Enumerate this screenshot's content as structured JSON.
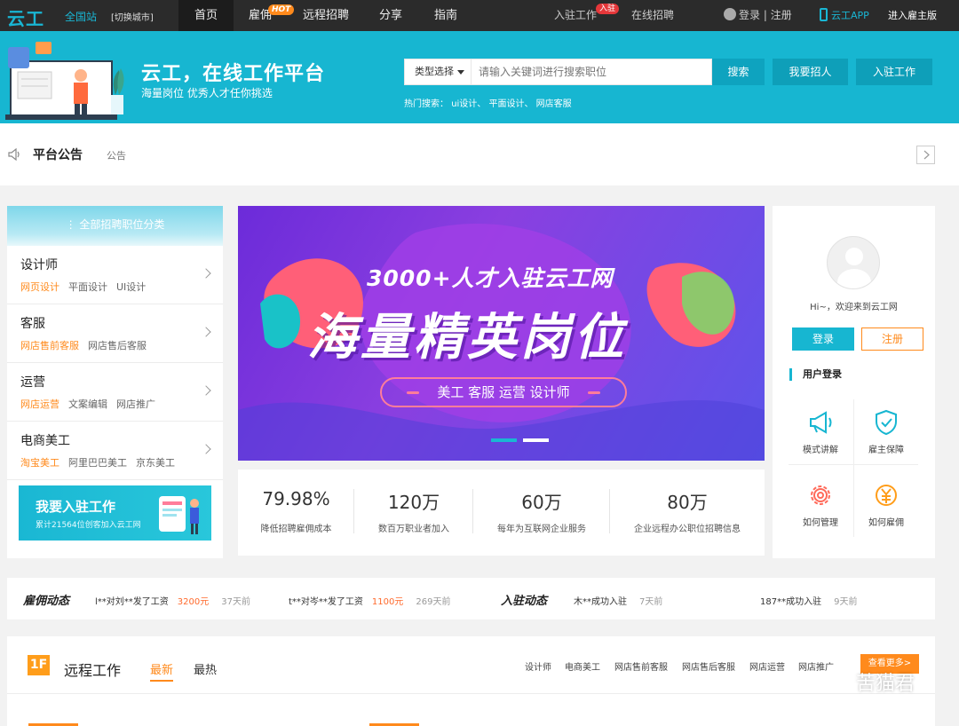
{
  "topbar": {
    "logo": "云工",
    "city": "全国站",
    "switch_city": "[切换城市]",
    "nav": [
      {
        "label": "首页",
        "active": true
      },
      {
        "label": "雇佣",
        "badge": "HOT"
      },
      {
        "label": "远程招聘"
      },
      {
        "label": "分享"
      },
      {
        "label": "指南"
      }
    ],
    "join_work": "入驻工作",
    "join_badge": "入驻",
    "online_recruit": "在线招聘",
    "login": "登录",
    "separator": "|",
    "register": "注册",
    "app": "云工APP",
    "employer": "进入雇主版"
  },
  "header": {
    "slogan": "云工，在线工作平台",
    "sub": "海量岗位 优秀人才任你挑选",
    "search_type": "类型选择",
    "search_placeholder": "请输入关键词进行搜索职位",
    "search_btn": "搜索",
    "hire_btn": "我要招人",
    "join_btn": "入驻工作",
    "hot_label": "热门搜索：",
    "hot_items": "ui设计、 平面设计、 网店客服"
  },
  "notice": {
    "title": "平台公告",
    "label": "公告"
  },
  "categories": {
    "title": "全部招聘职位分类",
    "items": [
      {
        "name": "设计师",
        "subs": [
          "网页设计",
          "平面设计",
          "UI设计"
        ]
      },
      {
        "name": "客服",
        "subs": [
          "网店售前客服",
          "网店售后客服"
        ]
      },
      {
        "name": "运营",
        "subs": [
          "网店运营",
          "文案编辑",
          "网店推广"
        ]
      },
      {
        "name": "电商美工",
        "subs": [
          "淘宝美工",
          "阿里巴巴美工",
          "京东美工"
        ]
      }
    ],
    "promo_title": "我要入驻工作",
    "promo_sub": "累计21564位创客加入云工网"
  },
  "banner": {
    "line1": "3000+人才入驻云工网",
    "line2": "海量精英岗位",
    "pill": "美工 客服 运营 设计师"
  },
  "stats": [
    {
      "num": "79.98%",
      "label": "降低招聘雇佣成本"
    },
    {
      "num": "120万",
      "label": "数百万职业者加入"
    },
    {
      "num": "60万",
      "label": "每年为互联网企业服务"
    },
    {
      "num": "80万",
      "label": "企业远程办公职位招聘信息"
    }
  ],
  "user": {
    "greeting": "Hi~，欢迎来到云工网",
    "login": "登录",
    "register": "注册",
    "section": "用户登录",
    "grid": [
      {
        "label": "模式讲解",
        "icon": "megaphone-icon"
      },
      {
        "label": "雇主保障",
        "icon": "shield-check-icon"
      },
      {
        "label": "如何管理",
        "icon": "gear-icon"
      },
      {
        "label": "如何雇佣",
        "icon": "yen-coin-icon"
      }
    ]
  },
  "ticker": {
    "hire_title": "雇佣动态",
    "join_title": "入驻动态",
    "hire_items": [
      {
        "text": "l**对刘**发了工资",
        "money": "3200元",
        "ago": "37天前"
      },
      {
        "text": "t**对岑**发了工资",
        "money": "1100元",
        "ago": "269天前"
      }
    ],
    "join_items": [
      {
        "text": "木**成功入驻",
        "ago": "7天前"
      },
      {
        "text": "187**成功入驻",
        "ago": "9天前"
      }
    ]
  },
  "floor": {
    "badge": "1F",
    "title": "远程工作",
    "tabs": [
      "最新",
      "最热"
    ],
    "cats": [
      "设计师",
      "电商美工",
      "网店售前客服",
      "网店售后客服",
      "网店运营",
      "网店推广"
    ],
    "more": "查看更多>"
  },
  "watermark": "苦猫君",
  "colors": {
    "brand": "#17b6d1",
    "accent": "#ff8a1c",
    "topbar": "#2b2b2b"
  }
}
